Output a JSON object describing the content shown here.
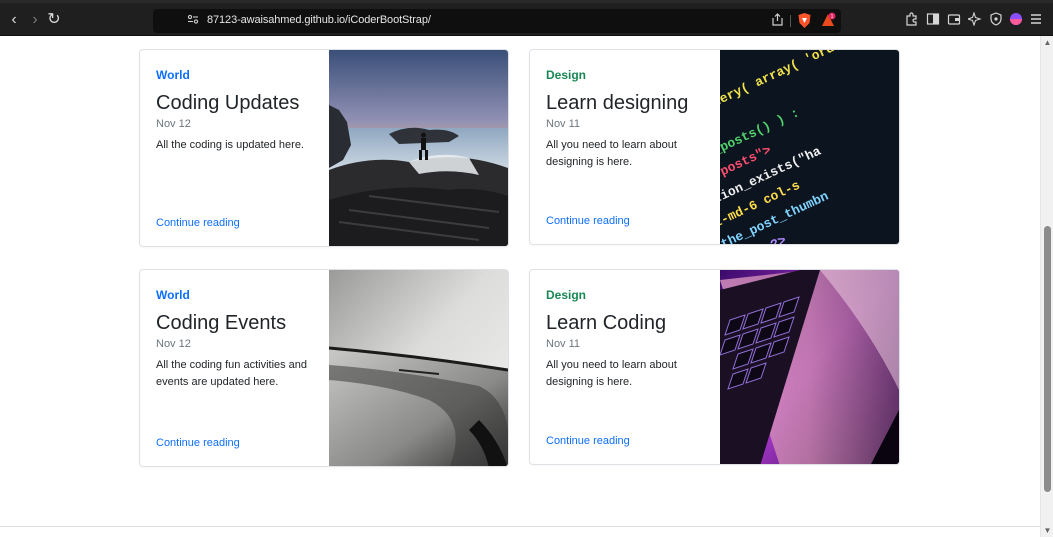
{
  "browser": {
    "url": "87123-awaisahmed.github.io/iCoderBootStrap/",
    "nav_back": "‹",
    "nav_forward": "›",
    "nav_reload": "↻",
    "icons": [
      "bookmark-icon",
      "site-settings-icon",
      "share-icon",
      "brave-shields-icon",
      "brave-rewards-icon",
      "extensions-icon",
      "sidebar-icon",
      "wallet-icon",
      "leo-ai-icon",
      "vpn-icon",
      "profile-icon",
      "menu-icon"
    ]
  },
  "cards": [
    {
      "category": "World",
      "category_color": "#0d6efd",
      "title": "Coding Updates",
      "date": "Nov 12",
      "description": "All the coding is updated here.",
      "link": "Continue reading",
      "image": "ocean-rocks-photo"
    },
    {
      "category": "Design",
      "category_color": "#198754",
      "title": "Learn designing",
      "date": "Nov 11",
      "description": "All you need to learn about designing is here.",
      "link": "Continue reading",
      "image": "code-screen-photo"
    },
    {
      "category": "World",
      "category_color": "#0d6efd",
      "title": "Coding Events",
      "date": "Nov 12",
      "description": "All the coding fun activities and events are updated here.",
      "link": "Continue reading",
      "image": "phone-closeup-photo"
    },
    {
      "category": "Design",
      "category_color": "#198754",
      "title": "Learn Coding",
      "date": "Nov 11",
      "description": "All you need to learn about designing is here.",
      "link": "Continue reading",
      "image": "laptop-keyboard-photo"
    }
  ]
}
